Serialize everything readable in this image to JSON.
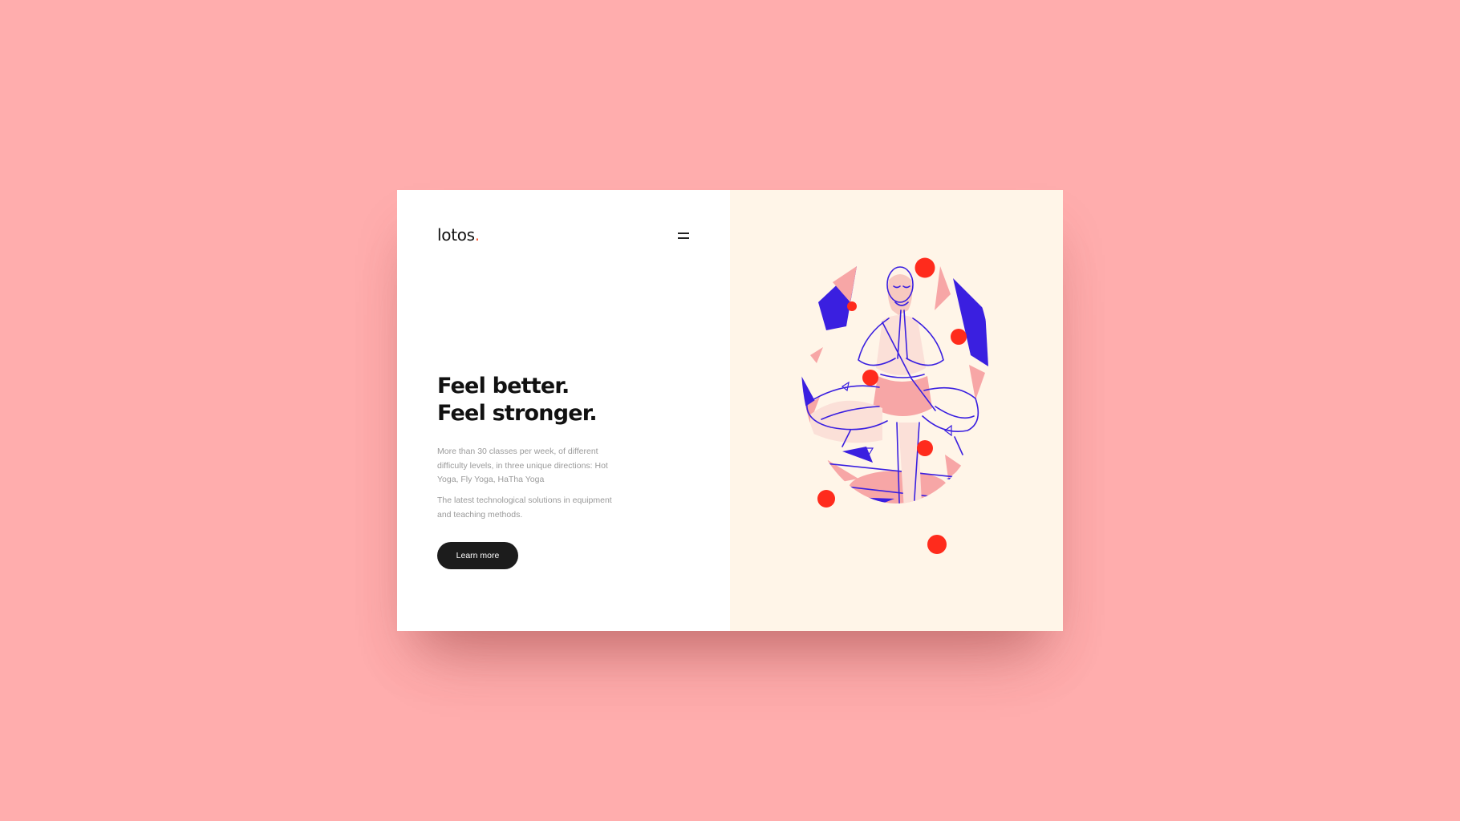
{
  "brand": {
    "name": "lotos",
    "dot": ".",
    "dot_color": "#ff5a36"
  },
  "header": {
    "menu_icon": "hamburger-menu-icon"
  },
  "hero": {
    "headline_line1": "Feel better.",
    "headline_line2": "Feel stronger.",
    "paragraph1": "More than 30 classes per week, of different difficulty levels, in three unique directions: Hot Yoga, Fly Yoga, HaTha Yoga",
    "paragraph2": "The latest technological solutions in equipment and teaching methods.",
    "cta_label": "Learn more"
  },
  "illustration": {
    "subject": "yoga-tree-pose-illustration",
    "colors": {
      "primary_blue": "#3a1fe0",
      "accent_red": "#ff2b1c",
      "accent_pink": "#f7a6a6"
    }
  },
  "theme": {
    "background": "#ffadad",
    "card_left": "#ffffff",
    "card_right": "#fff5e8",
    "button": "#1c1c1c"
  }
}
